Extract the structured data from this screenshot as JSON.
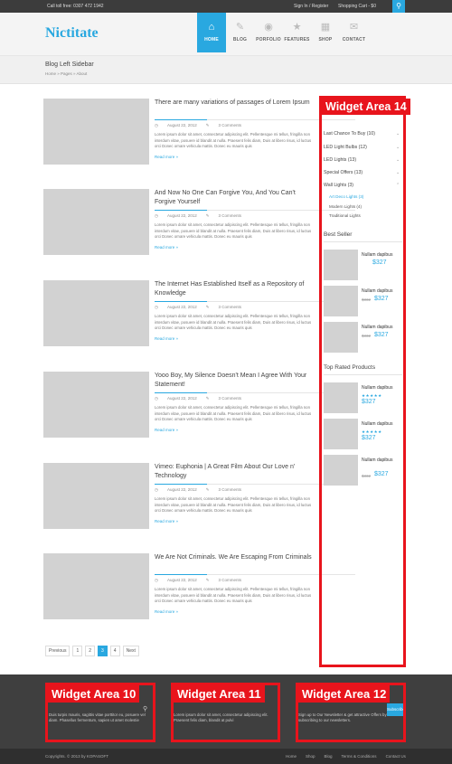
{
  "topbar": {
    "phone": "Call toll free: 0307 472 1942",
    "login": "Sign In / Register",
    "cart": "Shopping Cart - $0",
    "search_icon": "search-icon"
  },
  "header": {
    "logo": "Nictitate"
  },
  "nav": [
    {
      "label": "HOME",
      "icon": "home-icon"
    },
    {
      "label": "BLOG",
      "icon": "pencil-icon"
    },
    {
      "label": "PORFOLIO",
      "icon": "camera-icon"
    },
    {
      "label": "FEATURES",
      "icon": "star-icon"
    },
    {
      "label": "SHOP",
      "icon": "gift-icon"
    },
    {
      "label": "CONTACT",
      "icon": "mail-icon"
    }
  ],
  "page": {
    "title": "Blog Left Sidebar",
    "breadcrumb": "Home  »  Pages  »  About"
  },
  "posts": [
    {
      "title": "There are many variations of passages of Lorem Ipsum",
      "date": "August 22, 2012",
      "comments": "3 Comments",
      "excerpt": "Lorem ipsum dolor sit amet, consectetur adipiscing elit. Pellentesque mi tellus, fringilla non interdum vitae, posuere id blandit at nulla. Praesent felis diam, Duis at libero risus, id luctus orci Donec ornare vehicula mattis. Donec eu mauris quis",
      "more": "Read more »"
    },
    {
      "title": "And Now No One Can Forgive You, And You Can't Forgive Yourself",
      "date": "August 22, 2012",
      "comments": "3 Comments",
      "excerpt": "Lorem ipsum dolor sit amet, consectetur adipiscing elit. Pellentesque mi tellus, fringilla non interdum vitae, posuere id blandit at nulla. Praesent felis diam, Duis at libero risus, id luctus orci Donec ornare vehicula mattis. Donec eu mauris quis",
      "more": "Read more »"
    },
    {
      "title": "The Internet Has Established Itself as a Repository of Knowledge",
      "date": "August 22, 2012",
      "comments": "3 Comments",
      "excerpt": "Lorem ipsum dolor sit amet, consectetur adipiscing elit. Pellentesque mi tellus, fringilla non interdum vitae, posuere id blandit at nulla. Praesent felis diam, Duis at libero risus, id luctus orci Donec ornare vehicula mattis. Donec eu mauris quis",
      "more": "Read more »"
    },
    {
      "title": "Yooo Boy, My Silence Doesn't Mean I Agree With Your Statement!",
      "date": "August 22, 2012",
      "comments": "3 Comments",
      "excerpt": "Lorem ipsum dolor sit amet, consectetur adipiscing elit. Pellentesque mi tellus, fringilla non interdum vitae, posuere id blandit at nulla. Praesent felis diam, Duis at libero risus, id luctus orci Donec ornare vehicula mattis. Donec eu mauris quis",
      "more": "Read more »"
    },
    {
      "title": "Vimeo: Euphonia | A Great Film About Our Love n' Technology",
      "date": "August 22, 2012",
      "comments": "3 Comments",
      "excerpt": "Lorem ipsum dolor sit amet, consectetur adipiscing elit. Pellentesque mi tellus, fringilla non interdum vitae, posuere id blandit at nulla. Praesent felis diam, Duis at libero risus, id luctus orci Donec ornare vehicula mattis. Donec eu mauris quis",
      "more": "Read more »"
    },
    {
      "title": "We Are Not Criminals. We Are Escaping From Criminals",
      "date": "August 22, 2012",
      "comments": "3 Comments",
      "excerpt": "Lorem ipsum dolor sit amet, consectetur adipiscing elit. Pellentesque mi tellus, fringilla non interdum vitae, posuere id blandit at nulla. Praesent felis diam, Duis at libero risus, id luctus orci Donec ornare vehicula mattis. Donec eu mauris quis",
      "more": "Read more »"
    }
  ],
  "pagination": {
    "prev": "Previous",
    "pages": [
      "1",
      "2",
      "3",
      "4"
    ],
    "current": "3",
    "next": "Next"
  },
  "sidebar": {
    "widget_label": "Widget Area 14",
    "categories": [
      "Last Chance To Buy (10)",
      "LED Light Bulbs (12)",
      "LED Lights (13)",
      "Special Offers (13)",
      "Wall Lights (3)"
    ],
    "subcategories": [
      "Art Deco Lights (3)",
      "Modern Lights (4)",
      "Traditional Lights"
    ],
    "best_seller_title": "Best Seller",
    "best_sellers": [
      {
        "name": "Nullam dapibus",
        "old": "",
        "price": "$327"
      },
      {
        "name": "Nullam dapibus",
        "old": "$332",
        "price": "$327"
      },
      {
        "name": "Nullam dapibus",
        "old": "$332",
        "price": "$327"
      }
    ],
    "top_rated_title": "Top Rated Products",
    "top_rated": [
      {
        "name": "Nullam dapibus",
        "stars": "★★★★★",
        "old": "",
        "price": "$327"
      },
      {
        "name": "Nullam dapibus",
        "stars": "★★★★★",
        "old": "",
        "price": "$327"
      },
      {
        "name": "Nullam dapibus",
        "stars": "",
        "old": "$332",
        "price": "$327"
      }
    ]
  },
  "footer": {
    "widget_10": "Widget Area 10",
    "widget_11": "Widget Area 11",
    "widget_12": "Widget Area 12",
    "text_10": "Duis turpis mauris, sagittis vitae porttitor eu, posuere vel diam. Phasellus fermentum, sapien ut amet molestie",
    "text_11": "Lorem ipsum dolor sit amet, consectetur adipiscing elit. Praesent felis diam, blandit at pulvi",
    "text_12": "Sign up to Our Newsletter & get attractive Offers by subscribing to our newsletters.",
    "subscribe": "Subscribe",
    "copyright": "Copyrights. © 2013 by KOPASOFT",
    "links": [
      "Home",
      "Shop",
      "Blog",
      "Terms & Conditions",
      "Contact Us"
    ]
  },
  "colors": {
    "accent": "#29a8e0",
    "annotation": "#e8141c"
  }
}
